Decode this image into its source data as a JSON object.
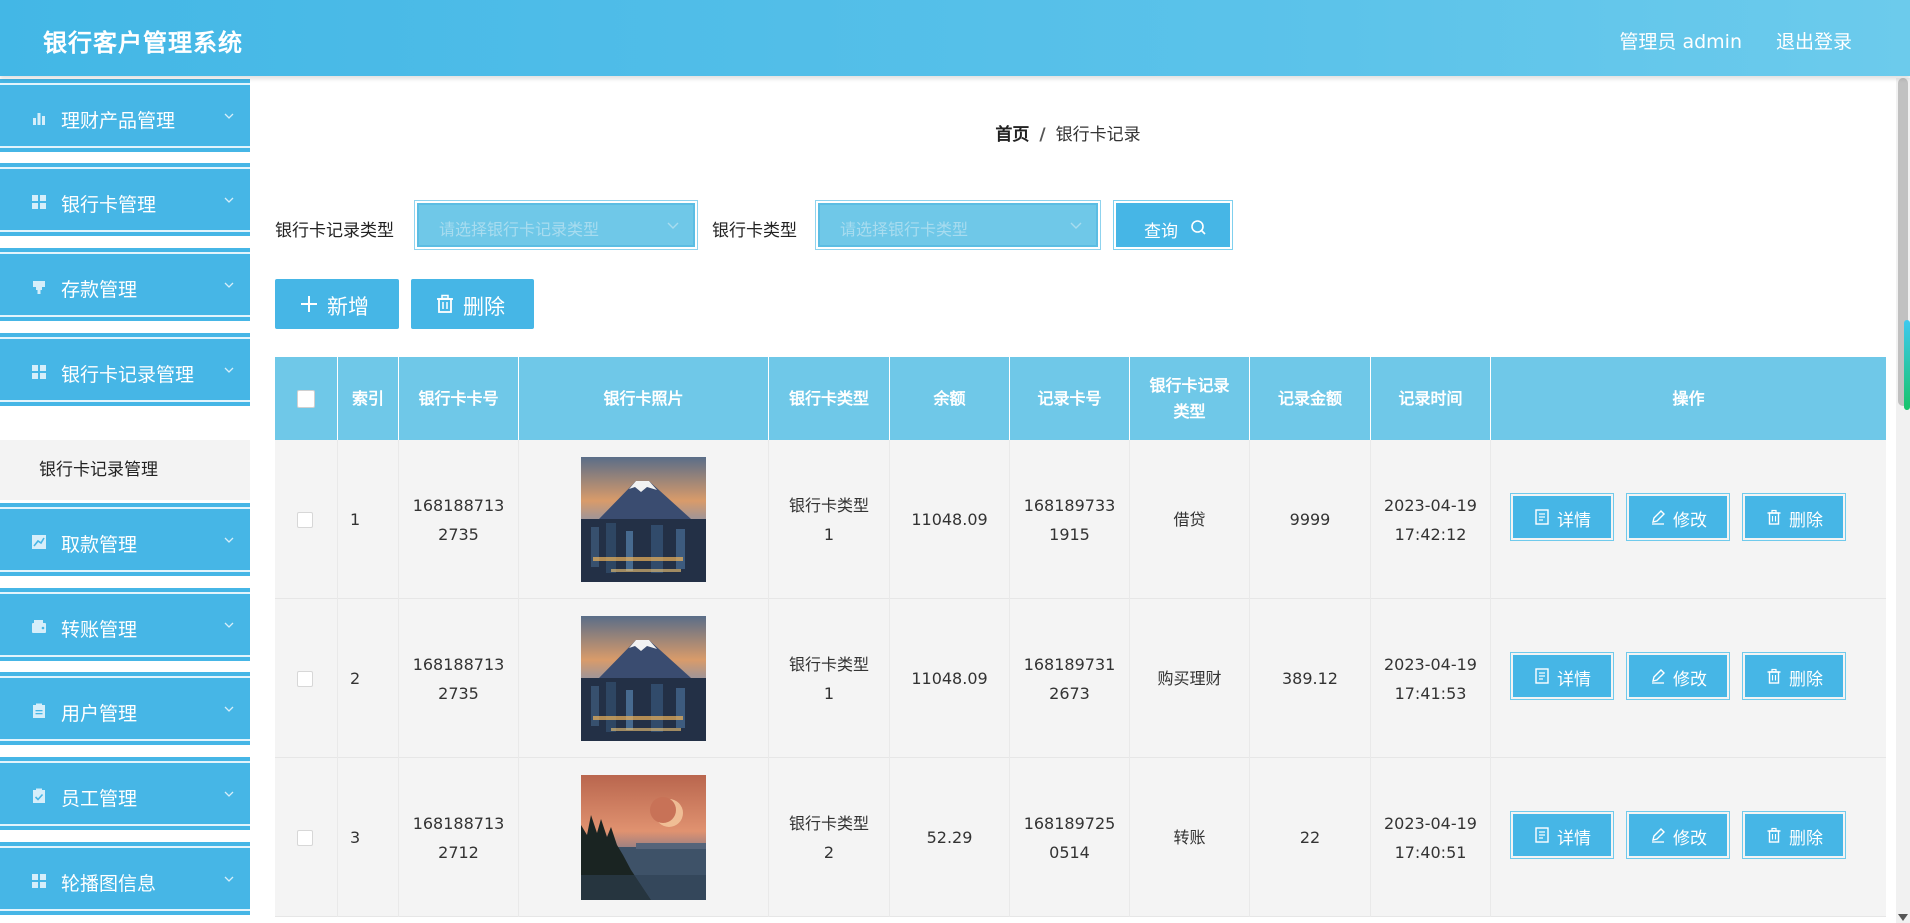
{
  "app": {
    "title": "银行客户管理系统",
    "user": "管理员 admin",
    "logout": "退出登录"
  },
  "sidebar": {
    "items": [
      {
        "label": "理财产品管理",
        "icon": "bar-chart-icon"
      },
      {
        "label": "银行卡管理",
        "icon": "grid-icon"
      },
      {
        "label": "存款管理",
        "icon": "stamp-icon"
      },
      {
        "label": "银行卡记录管理",
        "icon": "grid-icon"
      },
      {
        "label": "取款管理",
        "icon": "chart-box-icon"
      },
      {
        "label": "转账管理",
        "icon": "wallet-icon"
      },
      {
        "label": "用户管理",
        "icon": "clipboard-icon"
      },
      {
        "label": "员工管理",
        "icon": "clipboard-check-icon"
      },
      {
        "label": "轮播图信息",
        "icon": "grid-icon"
      }
    ],
    "subitem": "银行卡记录管理"
  },
  "breadcrumb": {
    "home": "首页",
    "separator": "/",
    "current": "银行卡记录"
  },
  "filters": {
    "record_type_label": "银行卡记录类型",
    "record_type_placeholder": "请选择银行卡记录类型",
    "card_type_label": "银行卡类型",
    "card_type_placeholder": "请选择银行卡类型",
    "query_label": "查询"
  },
  "actions": {
    "add_label": "新增",
    "delete_label": "删除"
  },
  "table": {
    "columns": [
      "索引",
      "银行卡卡号",
      "银行卡照片",
      "银行卡类型",
      "余额",
      "记录卡号",
      "银行卡记录类型",
      "记录金额",
      "记录时间",
      "操作"
    ],
    "rows": [
      {
        "index": "1",
        "card_no": [
          "168188713",
          "2735"
        ],
        "photo": "mount-fuji-city",
        "card_type": [
          "银行卡类型",
          "1"
        ],
        "balance": "11048.09",
        "record_no": [
          "168189733",
          "1915"
        ],
        "record_type": "借贷",
        "amount": "9999",
        "time": [
          "2023-04-19",
          "17:42:12"
        ]
      },
      {
        "index": "2",
        "card_no": [
          "168188713",
          "2735"
        ],
        "photo": "mount-fuji-city",
        "card_type": [
          "银行卡类型",
          "1"
        ],
        "balance": "11048.09",
        "record_no": [
          "168189731",
          "2673"
        ],
        "record_type": "购买理财",
        "amount": "389.12",
        "time": [
          "2023-04-19",
          "17:41:53"
        ]
      },
      {
        "index": "3",
        "card_no": [
          "168188713",
          "2712"
        ],
        "photo": "moon-over-lake",
        "card_type": [
          "银行卡类型",
          "2"
        ],
        "balance": "52.29",
        "record_no": [
          "168189725",
          "0514"
        ],
        "record_type": "转账",
        "amount": "22",
        "time": [
          "2023-04-19",
          "17:40:51"
        ]
      }
    ],
    "row_actions": {
      "detail": "详情",
      "edit": "修改",
      "delete": "删除"
    }
  },
  "colors": {
    "primary": "#46b6e6",
    "header_start": "#43b7e6",
    "table_header": "#6fc8e8",
    "row_bg": "#f4f4f4"
  }
}
